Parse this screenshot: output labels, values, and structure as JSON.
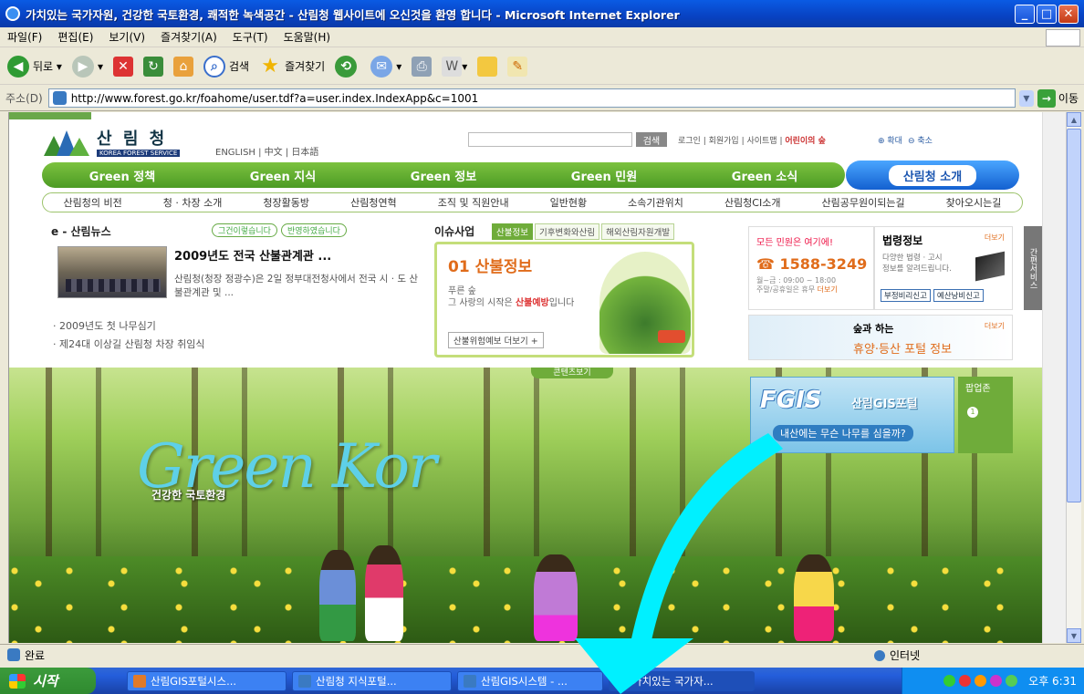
{
  "window": {
    "title": "가치있는 국가자원, 건강한 국토환경, 쾌적한 녹색공간 - 산림청 웹사이트에 오신것을 환영 합니다 - Microsoft Internet Explorer"
  },
  "menu": [
    "파일(F)",
    "편집(E)",
    "보기(V)",
    "즐겨찾기(A)",
    "도구(T)",
    "도움말(H)"
  ],
  "toolbar": {
    "back": "뒤로",
    "search": "검색",
    "favorites": "즐겨찾기"
  },
  "address": {
    "label": "주소(D)",
    "url": "http://www.forest.go.kr/foahome/user.tdf?a=user.index.IndexApp&c=1001",
    "go": "이동"
  },
  "page": {
    "logo": {
      "name": "산 림 청",
      "sub": "KOREA FOREST SERVICE"
    },
    "langs": "ENGLISH | 中文 | 日本語",
    "search_btn": "검색",
    "toplinks": "로그인 | 회원가입 | 사이트맵 | ",
    "toplinks_kids": "어린이의 숲",
    "zoom_in": "확대",
    "zoom_out": "축소",
    "nav": [
      "Green 정책",
      "Green 지식",
      "Green 정보",
      "Green 민원",
      "Green 소식"
    ],
    "nav_intro": "산림청 소개",
    "subnav": [
      "산림청의 비전",
      "청 · 차장 소개",
      "청장활동방",
      "산림청연혁",
      "조직 및 직원안내",
      "일반현황",
      "소속기관위치",
      "산림청CI소개",
      "산림공무원이되는길",
      "찾아오시는길"
    ],
    "news": {
      "title": "e - 산림뉴스",
      "btn1": "그건이렇습니다",
      "btn2": "반영하였습니다",
      "headline": "2009년도 전국 산불관계관 ...",
      "summary": "산림청(청장 정광수)은 2일 정부대전청사에서 전국 시 · 도 산불관계관 및 ...",
      "list": [
        "· 2009년도 첫 나무심기",
        "· 제24대 이상길 산림청 차장 취임식"
      ]
    },
    "issue": {
      "title": "이슈사업",
      "tabs": [
        "산불정보",
        "기후변화와산림",
        "해외산림자원개발"
      ],
      "heading": "01 산불정보",
      "desc1": "푸른 숲",
      "desc2": "그 사랑의 시작은 ",
      "desc_em": "산불예방",
      "desc3": "입니다",
      "more": "산불위험예보  더보기 +"
    },
    "contact": {
      "head": "모든 민원은 여기에!",
      "phone": "☎ 1588-3249",
      "hours": "월~금 : 09:00 ~ 18:00",
      "hours2": "주말/공휴일은 휴무",
      "more": "더보기"
    },
    "law": {
      "title": "법령정보",
      "more": "더보기",
      "desc1": "다양한 법령 · 고시",
      "desc2": "정보를 알려드립니다.",
      "btn1": "부정비리신고",
      "btn2": "예산낭비신고"
    },
    "quick": "간편서비스",
    "forest_banner": {
      "t1": "숲과 하는",
      "t2": "휴양·등산 포털 정보",
      "more": "더보기"
    },
    "hero": {
      "tab": "콘텐츠보기",
      "script": "Green Kor",
      "sub": "건강한 국토환경"
    },
    "gis": {
      "logo": "FGIS",
      "name": "산림GIS포털",
      "tag": "내산에는 무슨 나무를 심을까?"
    },
    "popupzone": {
      "title": "팝업존",
      "num": "1"
    }
  },
  "status": {
    "text": "완료",
    "zone": "인터넷"
  },
  "taskbar": {
    "start": "시작",
    "tasks": [
      "산림GIS포털시스...",
      "산림청 지식포털...",
      "산림GIS시스템 - ...",
      "가치있는 국가자..."
    ],
    "clock": "오후 6:31"
  },
  "colors": {
    "titlebar": "#0a5be4",
    "nav_green": "#4c9b24",
    "accent_orange": "#e06c1b",
    "annotation_arrow": "#00f0ff"
  }
}
